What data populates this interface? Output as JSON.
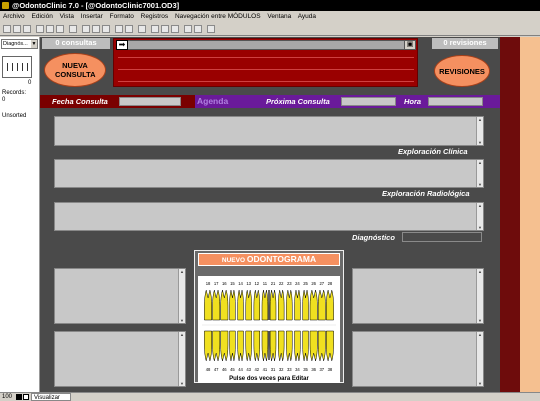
{
  "window": {
    "title": "@OdontoClinic 7.0 - [@OdontoClinic7001.OD3]"
  },
  "menu": [
    "Archivo",
    "Edición",
    "Vista",
    "Insertar",
    "Formato",
    "Registros",
    "Navegación entre MÓDULOS",
    "Ventana",
    "Ayuda"
  ],
  "left_panel": {
    "layout_select": "Diagnós...",
    "record_number": "0",
    "records_label": "Records:",
    "records_value": "0",
    "sort_state": "Unsorted"
  },
  "consultas": {
    "count_label": "0 consultas",
    "new_button": "NUEVA CONSULTA"
  },
  "revisiones": {
    "count_label": "0 revisiones",
    "button": "REVISIONES"
  },
  "header_bar": {
    "fecha_label": "Fecha Consulta",
    "agenda_label": "Agenda",
    "proxima_label": "Próxima Consulta",
    "hora_label": "Hora"
  },
  "sections": {
    "exploracion_clinica": "Exploración Clínica",
    "exploracion_radiologica": "Exploración Radiológica",
    "diagnostico": "Diagnóstico"
  },
  "odontograma": {
    "title_prefix": "NUEVO",
    "title_main": "ODONTOGRAMA",
    "caption": "Pulse dos veces para Editar",
    "upper_numbers": [
      "18",
      "17",
      "16",
      "15",
      "14",
      "13",
      "12",
      "11",
      "21",
      "22",
      "23",
      "24",
      "25",
      "26",
      "27",
      "28"
    ],
    "lower_numbers": [
      "48",
      "47",
      "46",
      "45",
      "44",
      "43",
      "42",
      "41",
      "31",
      "32",
      "33",
      "34",
      "35",
      "36",
      "37",
      "38"
    ]
  },
  "status_bar": {
    "zoom": "100",
    "mode": "Visualizar"
  },
  "colors": {
    "main_bg": "#4a4a4a",
    "accent_red": "#9a0000",
    "accent_purple": "#6a1a9a",
    "orange_button": "#f59060",
    "right_strip_dark": "#6e0c0c",
    "right_strip_light": "#f5c090",
    "tooth_yellow": "#f0e020"
  }
}
